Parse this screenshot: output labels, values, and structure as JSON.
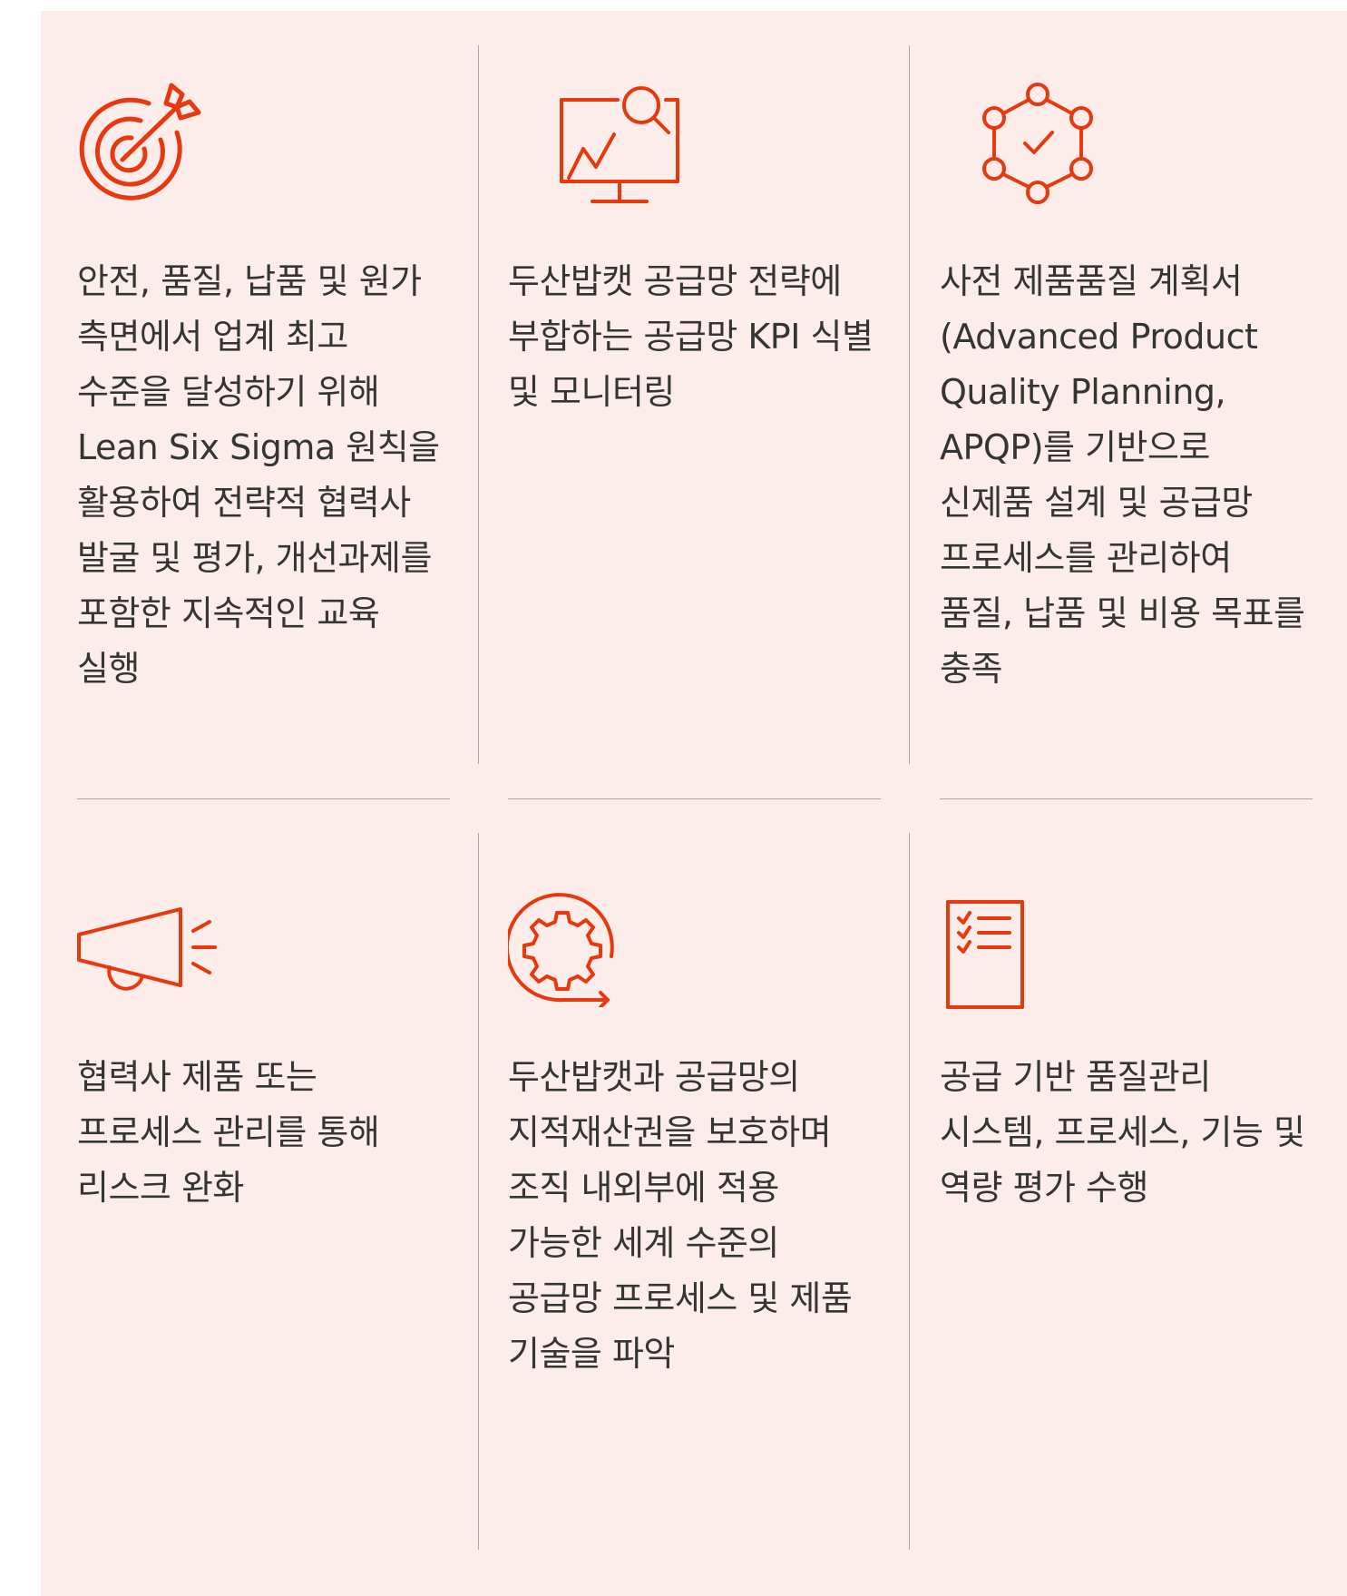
{
  "colors": {
    "accent": "#e8380d",
    "panel_background": "#fcedeb",
    "divider": "#a9a7a6",
    "text": "#353535"
  },
  "cards": [
    {
      "icon": "target-arrow-icon",
      "text": "안전, 품질, 납품 및 원가\n측면에서 업계 최고\n수준을 달성하기 위해\nLean Six Sigma 원칙을\n활용하여 전략적 협력사\n발굴 및 평가, 개선과제를\n포함한 지속적인 교육\n실행"
    },
    {
      "icon": "monitor-chart-magnifier-icon",
      "text": "두산밥캣 공급망 전략에\n부합하는 공급망 KPI 식별\n및 모니터링"
    },
    {
      "icon": "network-hexagon-check-icon",
      "text": "사전 제품품질 계획서\n(Advanced Product\nQuality Planning,\nAPQP)를 기반으로\n신제품 설계 및 공급망\n프로세스를 관리하여\n품질, 납품 및 비용 목표를\n충족"
    },
    {
      "icon": "megaphone-icon",
      "text": "협력사 제품 또는\n프로세스 관리를 통해\n리스크 완화"
    },
    {
      "icon": "gear-cycle-arrow-icon",
      "text": "두산밥캣과 공급망의\n지적재산권을 보호하며\n조직 내외부에 적용\n가능한 세계 수준의\n공급망 프로세스 및 제품\n기술을 파악"
    },
    {
      "icon": "checklist-document-icon",
      "text": "공급 기반 품질관리\n시스템, 프로세스, 기능 및\n역량 평가 수행"
    }
  ]
}
